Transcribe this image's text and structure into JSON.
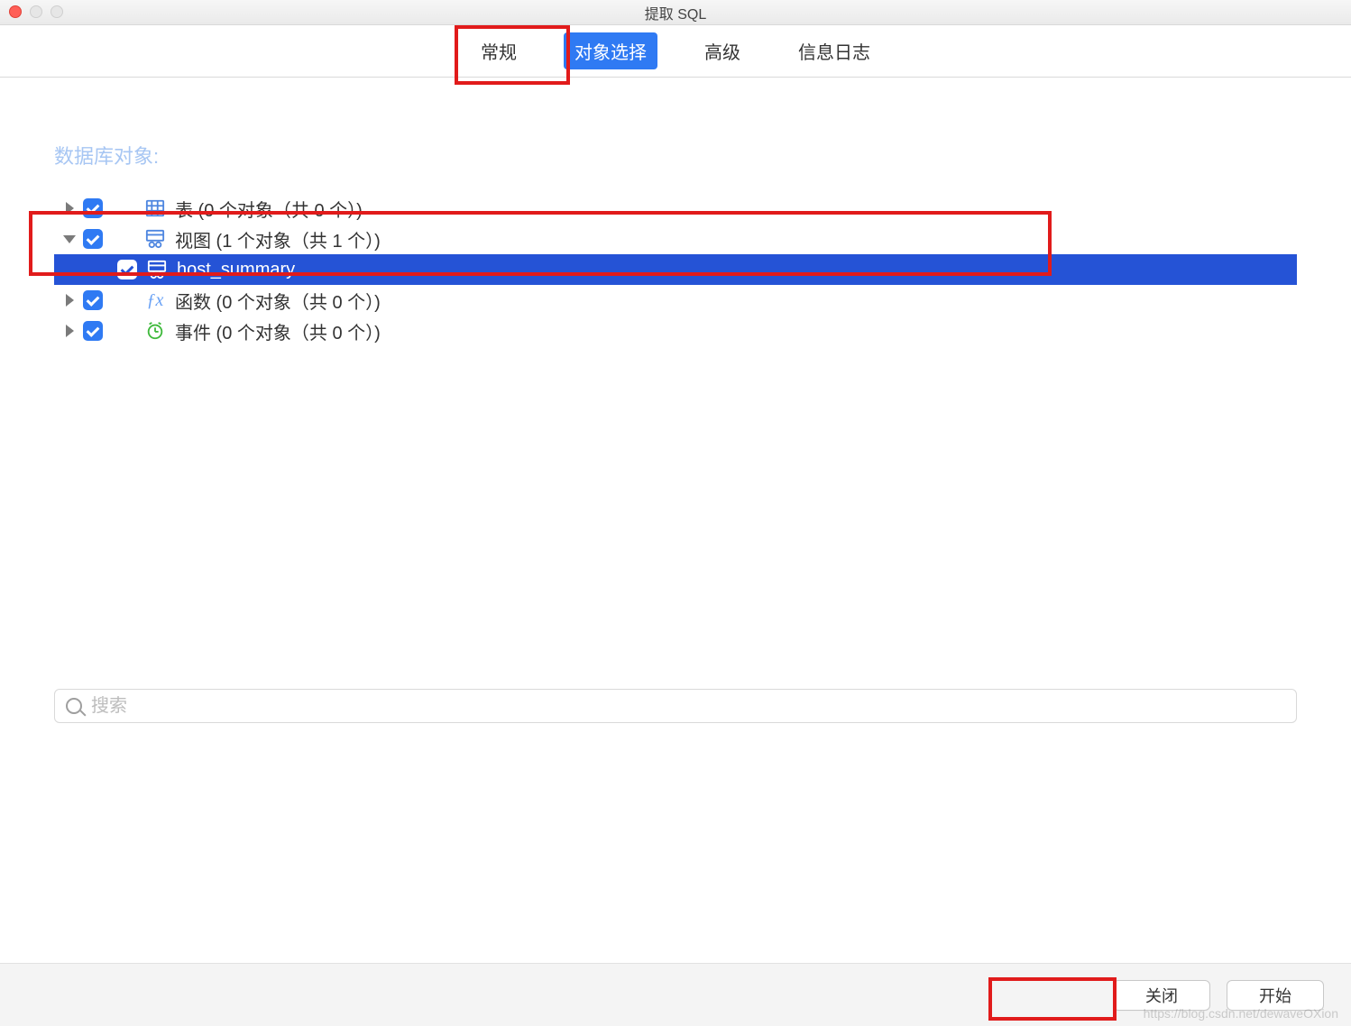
{
  "window": {
    "title": "提取 SQL"
  },
  "tabs": {
    "items": [
      {
        "label": "常规",
        "active": false
      },
      {
        "label": "对象选择",
        "active": true
      },
      {
        "label": "高级",
        "active": false
      },
      {
        "label": "信息日志",
        "active": false
      }
    ]
  },
  "section": {
    "title": "数据库对象:"
  },
  "tree": {
    "rows": [
      {
        "icon": "table-icon",
        "label": "表 (0 个对象（共 0 个）)",
        "expanded": false,
        "checked": true,
        "selected": false,
        "level": 0
      },
      {
        "icon": "view-icon",
        "label": "视图 (1 个对象（共 1 个）)",
        "expanded": true,
        "checked": true,
        "selected": false,
        "level": 0
      },
      {
        "icon": "view-icon",
        "label": "host_summary",
        "expanded": null,
        "checked": true,
        "selected": true,
        "level": 1
      },
      {
        "icon": "function-icon",
        "label": "函数 (0 个对象（共 0 个）)",
        "expanded": false,
        "checked": true,
        "selected": false,
        "level": 0
      },
      {
        "icon": "event-icon",
        "label": "事件 (0 个对象（共 0 个）)",
        "expanded": false,
        "checked": true,
        "selected": false,
        "level": 0
      }
    ]
  },
  "search": {
    "placeholder": "搜索"
  },
  "footer": {
    "close": "关闭",
    "start": "开始"
  },
  "watermark": "https://blog.csdn.net/dewaveOXion"
}
